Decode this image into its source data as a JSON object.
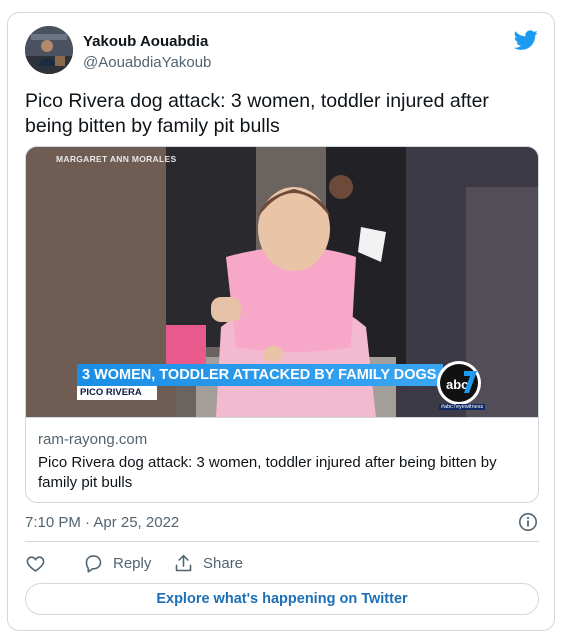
{
  "author": {
    "display_name": "Yakoub Aouabdia",
    "handle": "@AouabdiaYakoub"
  },
  "tweet": {
    "text": "Pico Rivera dog attack: 3 women, toddler injured after being bitten by family pit bulls",
    "timestamp": "7:10 PM · Apr 25, 2022"
  },
  "link_card": {
    "media": {
      "credit": "MARGARET ANN MORALES",
      "headline": "3 WOMEN, TODDLER ATTACKED BY FAMILY DOGS",
      "location": "PICO RIVERA",
      "logo_text": "abc",
      "hashtag": "#abc7eyewitness"
    },
    "domain": "ram-rayong.com",
    "title": "Pico Rivera dog attack: 3 women, toddler injured after being bitten by family pit bulls"
  },
  "actions": {
    "reply_label": "Reply",
    "share_label": "Share"
  },
  "cta_label": "Explore what's happening on Twitter",
  "icons": {
    "brand": "twitter-bird-icon",
    "info": "info-icon",
    "like": "heart-icon",
    "reply": "reply-icon",
    "share": "share-icon"
  },
  "colors": {
    "twitter_blue": "#1d9bf0",
    "secondary_text": "#536471",
    "border": "#cfd9de",
    "lower_third_blue": "#1a8ee6"
  }
}
